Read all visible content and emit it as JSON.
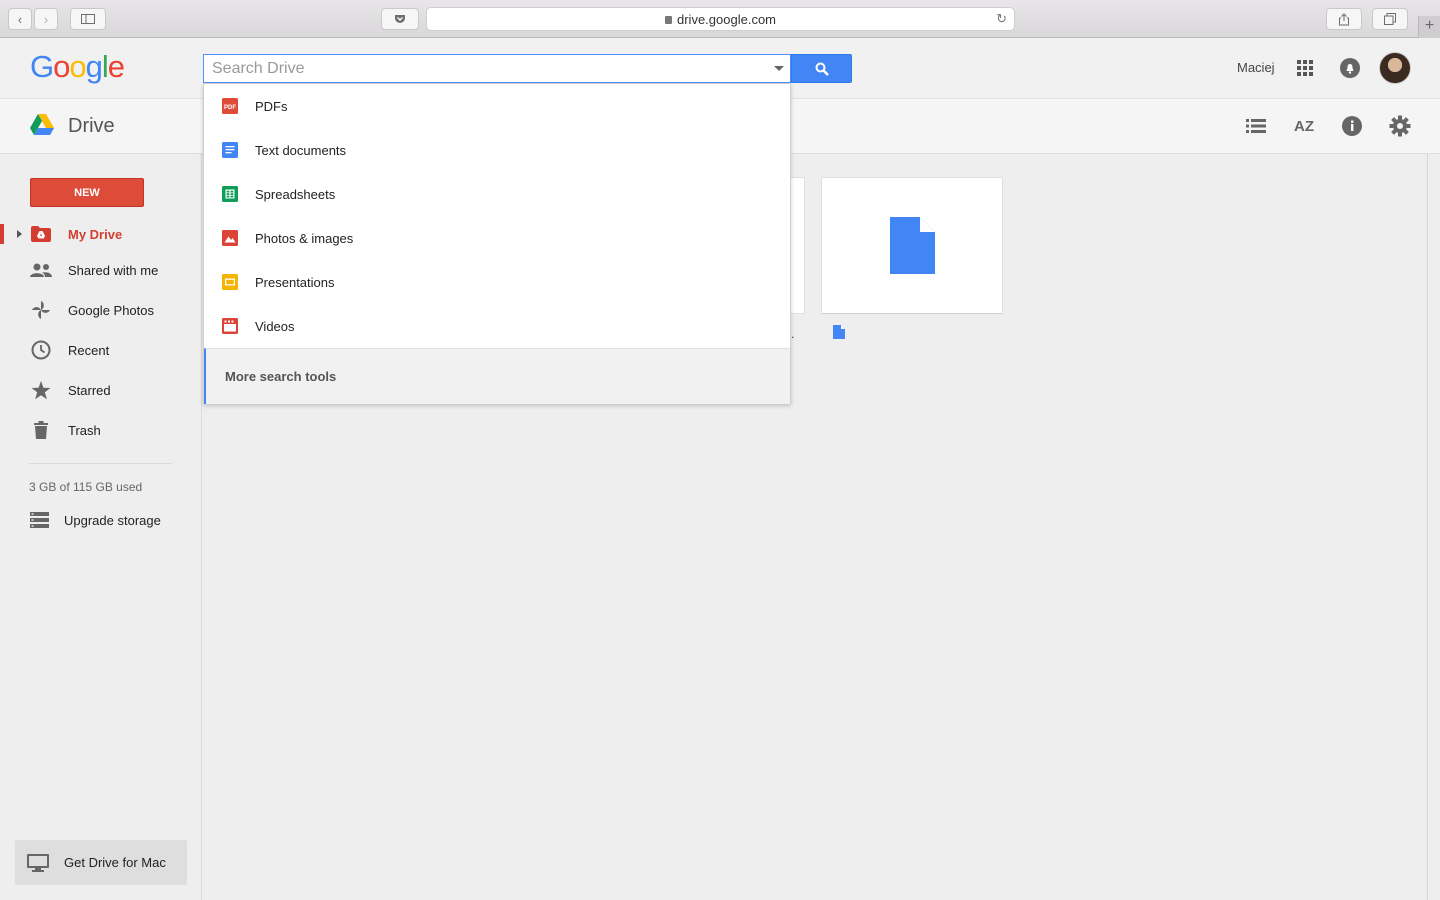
{
  "browser": {
    "url": "drive.google.com"
  },
  "header": {
    "logo_letters": [
      "G",
      "o",
      "o",
      "g",
      "l",
      "e"
    ],
    "logo_colors": [
      "#4285f4",
      "#ea4335",
      "#fbbc05",
      "#4285f4",
      "#34a853",
      "#ea4335"
    ],
    "search_placeholder": "Search Drive",
    "user_name": "Maciej"
  },
  "toolbar": {
    "title": "Drive",
    "sort_label": "AZ"
  },
  "sidebar": {
    "new_label": "NEW",
    "items": [
      {
        "label": "My Drive",
        "icon": "my-drive-icon",
        "active": true
      },
      {
        "label": "Shared with me",
        "icon": "people-icon"
      },
      {
        "label": "Google Photos",
        "icon": "photos-pinwheel-icon"
      },
      {
        "label": "Recent",
        "icon": "clock-icon"
      },
      {
        "label": "Starred",
        "icon": "star-icon"
      },
      {
        "label": "Trash",
        "icon": "trash-icon"
      }
    ],
    "storage_text": "3 GB of 115 GB used",
    "upgrade_label": "Upgrade storage",
    "get_drive_label": "Get Drive for Mac"
  },
  "search_dropdown": {
    "items": [
      {
        "label": "PDFs",
        "icon": "pdf-icon",
        "color": "#dd4b39"
      },
      {
        "label": "Text documents",
        "icon": "docs-icon",
        "color": "#4285f4"
      },
      {
        "label": "Spreadsheets",
        "icon": "sheets-icon",
        "color": "#0f9d58"
      },
      {
        "label": "Photos & images",
        "icon": "image-icon",
        "color": "#db4437"
      },
      {
        "label": "Presentations",
        "icon": "slides-icon",
        "color": "#f4b400"
      },
      {
        "label": "Videos",
        "icon": "video-icon",
        "color": "#db4437"
      }
    ],
    "more_label": "More search tools"
  },
  "colors": {
    "accent_red": "#dd4b39",
    "accent_blue": "#4285f4"
  }
}
